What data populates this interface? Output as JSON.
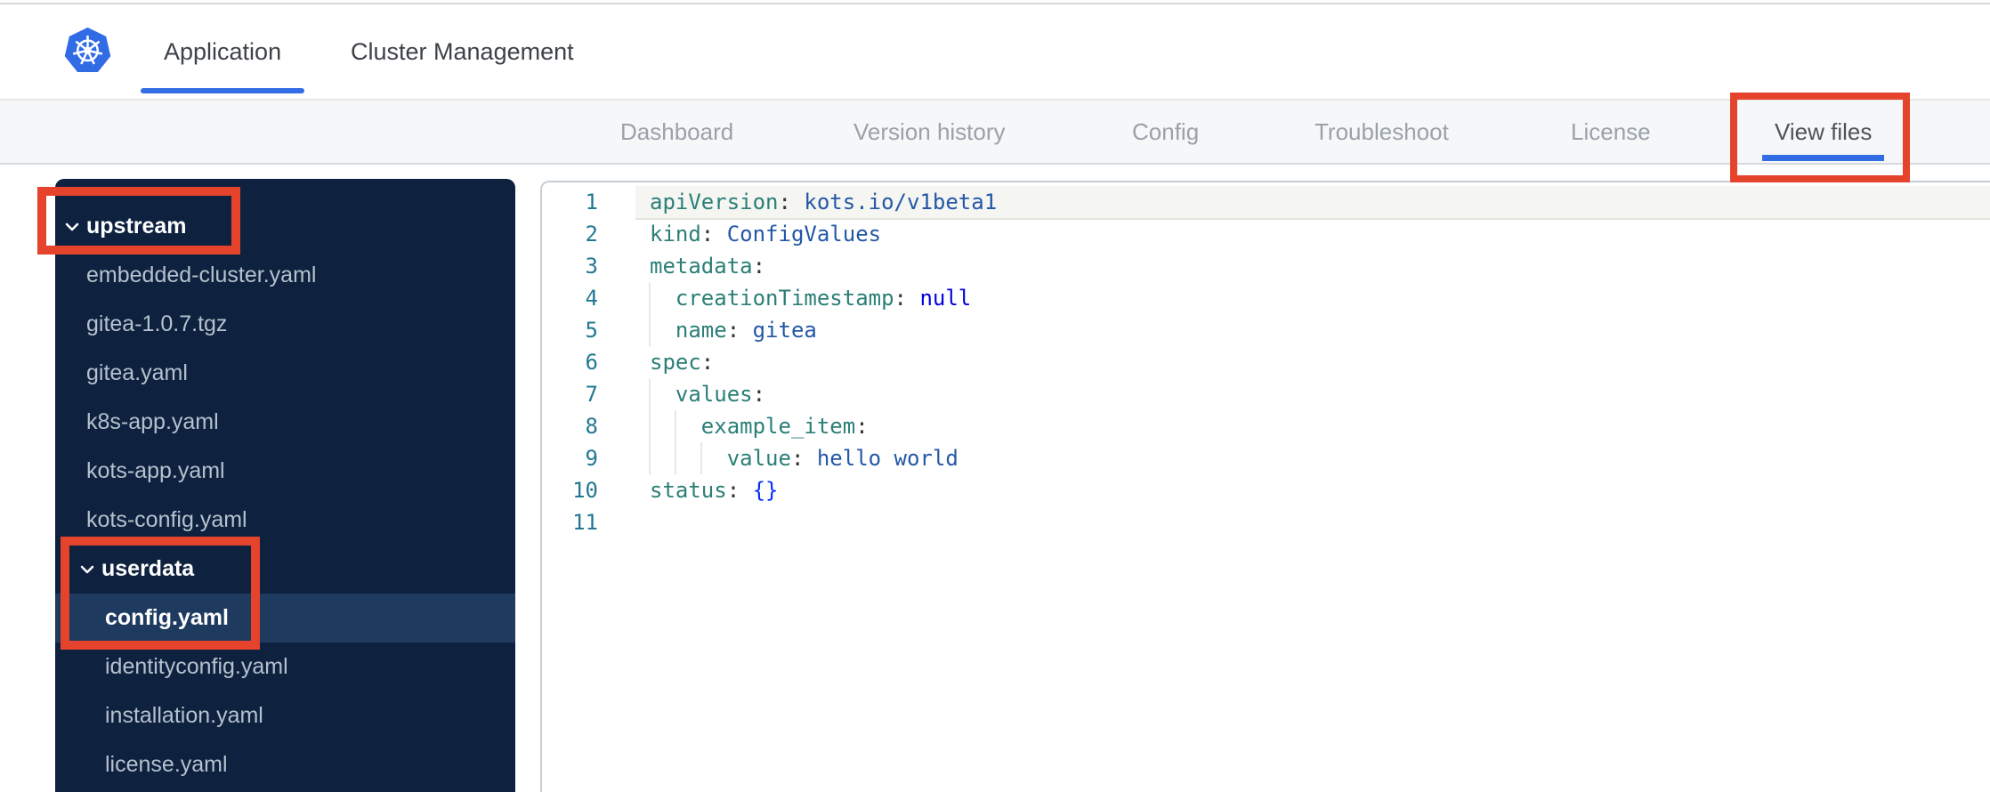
{
  "header": {
    "tabs": [
      {
        "label": "Application",
        "active": true
      },
      {
        "label": "Cluster Management",
        "active": false
      }
    ]
  },
  "subnav": {
    "items": [
      {
        "label": "Dashboard",
        "active": false
      },
      {
        "label": "Version history",
        "active": false
      },
      {
        "label": "Config",
        "active": false
      },
      {
        "label": "Troubleshoot",
        "active": false
      },
      {
        "label": "License",
        "active": false
      },
      {
        "label": "View files",
        "active": true,
        "annotated": true
      }
    ]
  },
  "file_tree": {
    "items": [
      {
        "type": "folder",
        "level": 0,
        "name": "upstream",
        "expanded": true,
        "annotated": true
      },
      {
        "type": "file",
        "level": 1,
        "name": "embedded-cluster.yaml"
      },
      {
        "type": "file",
        "level": 1,
        "name": "gitea-1.0.7.tgz"
      },
      {
        "type": "file",
        "level": 1,
        "name": "gitea.yaml"
      },
      {
        "type": "file",
        "level": 1,
        "name": "k8s-app.yaml"
      },
      {
        "type": "file",
        "level": 1,
        "name": "kots-app.yaml"
      },
      {
        "type": "file",
        "level": 1,
        "name": "kots-config.yaml"
      },
      {
        "type": "folder",
        "level": 1,
        "name": "userdata",
        "expanded": true,
        "annotated": true
      },
      {
        "type": "file",
        "level": 2,
        "name": "config.yaml",
        "selected": true,
        "annotated": true
      },
      {
        "type": "file",
        "level": 2,
        "name": "identityconfig.yaml"
      },
      {
        "type": "file",
        "level": 2,
        "name": "installation.yaml"
      },
      {
        "type": "file",
        "level": 2,
        "name": "license.yaml"
      }
    ]
  },
  "editor": {
    "language": "yaml",
    "lines": [
      {
        "num": "1",
        "current": true,
        "guides": 0,
        "tokens": [
          [
            "key",
            "apiVersion"
          ],
          [
            "p",
            ": "
          ],
          [
            "val",
            "kots.io/v1beta1"
          ]
        ]
      },
      {
        "num": "2",
        "guides": 0,
        "tokens": [
          [
            "key",
            "kind"
          ],
          [
            "p",
            ": "
          ],
          [
            "val",
            "ConfigValues"
          ]
        ]
      },
      {
        "num": "3",
        "guides": 0,
        "tokens": [
          [
            "key",
            "metadata"
          ],
          [
            "p",
            ":"
          ]
        ]
      },
      {
        "num": "4",
        "guides": 1,
        "tokens": [
          [
            "key",
            "  creationTimestamp"
          ],
          [
            "p",
            ": "
          ],
          [
            "kw",
            "null"
          ]
        ]
      },
      {
        "num": "5",
        "guides": 1,
        "tokens": [
          [
            "key",
            "  name"
          ],
          [
            "p",
            ": "
          ],
          [
            "val",
            "gitea"
          ]
        ]
      },
      {
        "num": "6",
        "guides": 0,
        "tokens": [
          [
            "key",
            "spec"
          ],
          [
            "p",
            ":"
          ]
        ]
      },
      {
        "num": "7",
        "guides": 1,
        "tokens": [
          [
            "key",
            "  values"
          ],
          [
            "p",
            ":"
          ]
        ]
      },
      {
        "num": "8",
        "guides": 2,
        "tokens": [
          [
            "key",
            "    example_item"
          ],
          [
            "p",
            ":"
          ]
        ]
      },
      {
        "num": "9",
        "guides": 3,
        "tokens": [
          [
            "key",
            "      value"
          ],
          [
            "p",
            ": "
          ],
          [
            "val",
            "hello world"
          ]
        ]
      },
      {
        "num": "10",
        "guides": 0,
        "tokens": [
          [
            "key",
            "status"
          ],
          [
            "p",
            ": "
          ],
          [
            "br",
            "{}"
          ]
        ]
      },
      {
        "num": "11",
        "guides": 0,
        "tokens": []
      }
    ]
  },
  "colors": {
    "accent_blue": "#326de6",
    "kubernetes_blue": "#326ce5",
    "annotation_red": "#e5432c",
    "sidebar_bg": "#0e2240",
    "selected_row_bg": "#1e3a5f",
    "subnav_bg": "#f6f7f9",
    "yaml_key": "#2b7f77",
    "yaml_value": "#2458a5",
    "yaml_keyword": "#0000e6",
    "yaml_bracket": "#0431fa",
    "line_number": "#237893"
  }
}
